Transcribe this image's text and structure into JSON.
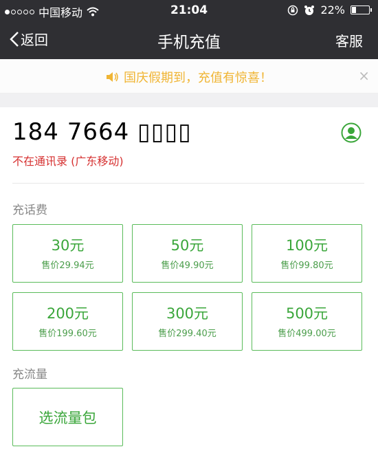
{
  "status": {
    "carrier": "中国移动",
    "time": "21:04",
    "battery": "22%",
    "battery_level": 0.22
  },
  "nav": {
    "back_label": "返回",
    "title": "手机充值",
    "service_label": "客服"
  },
  "notice": {
    "text": "国庆假期到，充值有惊喜！",
    "close": "×"
  },
  "phone": {
    "number": "184 7664 ▯▯▯▯",
    "subtitle": "不在通讯录 (广东移动)"
  },
  "recharge": {
    "title": "充话费",
    "options": [
      {
        "amount": "30元",
        "price": "售价29.94元"
      },
      {
        "amount": "50元",
        "price": "售价49.90元"
      },
      {
        "amount": "100元",
        "price": "售价99.80元"
      },
      {
        "amount": "200元",
        "price": "售价199.60元"
      },
      {
        "amount": "300元",
        "price": "售价299.40元"
      },
      {
        "amount": "500元",
        "price": "售价499.00元"
      }
    ]
  },
  "data": {
    "title": "充流量",
    "button": "选流量包"
  },
  "colors": {
    "accent": "#3aa63a",
    "warning": "#f0b534",
    "red_text": "#d63030",
    "nav_bg": "#2f2f33"
  },
  "icons": {
    "back": "chevron-left-icon",
    "speaker": "speaker-icon",
    "contact": "contact-person-icon",
    "wifi": "wifi-icon",
    "alarm": "alarm-icon",
    "lock_rotation": "rotation-lock-icon"
  }
}
